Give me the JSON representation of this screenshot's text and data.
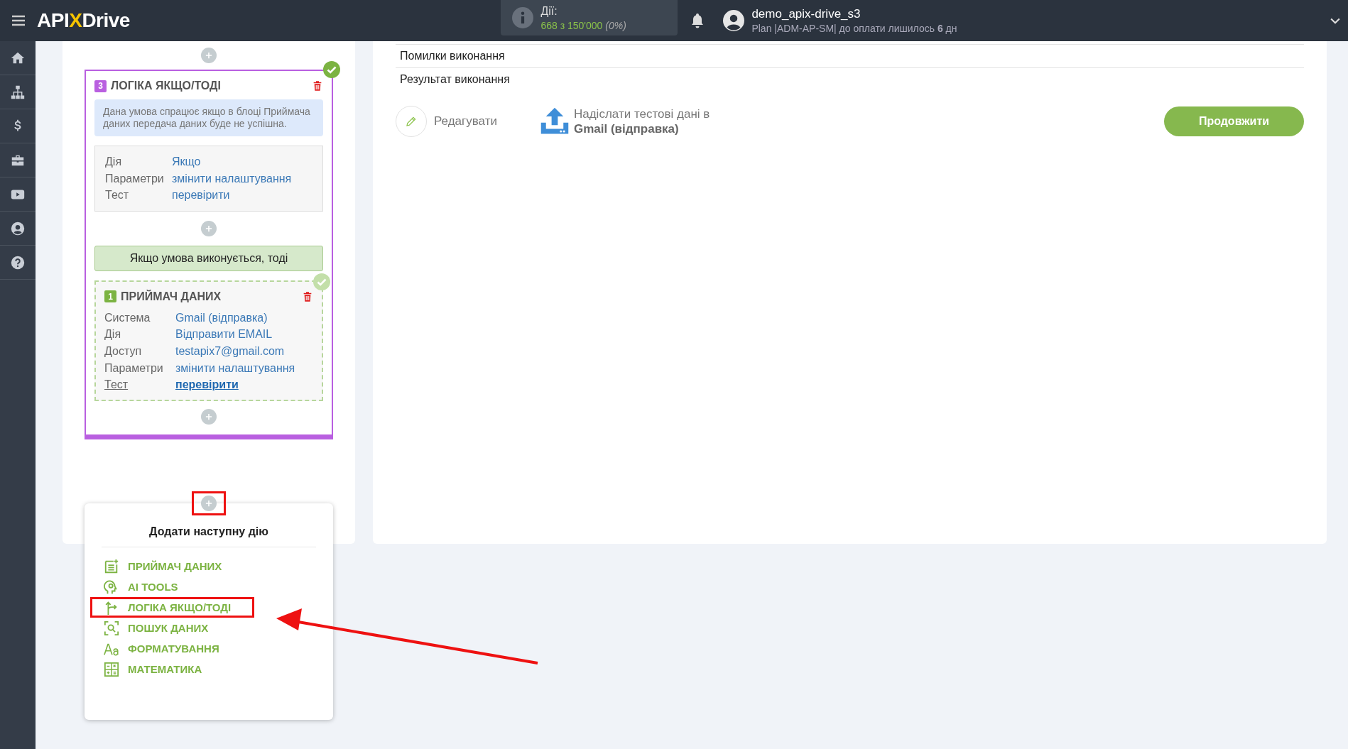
{
  "header": {
    "logo": {
      "left": "API",
      "mid": "X",
      "right": "Drive"
    },
    "actions": {
      "label": "Дії:",
      "count": "668",
      "of": "з 150'000",
      "percent": "(0%)"
    },
    "user": {
      "name": "demo_apix-drive_s3",
      "plan": "Plan |ADM-AP-SM| до оплати лишилось **6** дн"
    }
  },
  "logic_block": {
    "number": "3",
    "title": "ЛОГІКА ЯКЩО/ТОДІ",
    "done": true,
    "note": "Дана умова спрацює якщо в блоці Приймача даних передача даних буде не успішна.",
    "rows": [
      {
        "label": "Дія",
        "value": "Якщо",
        "hovered": false
      },
      {
        "label": "Параметри",
        "value": "змінити налаштування",
        "hovered": false
      },
      {
        "label": "Тест",
        "value": "перевірити",
        "hovered": false
      }
    ],
    "condition": "Якщо умова виконується, тоді",
    "receiver": {
      "number": "1",
      "title": "ПРИЙМАЧ ДАНИХ",
      "done": true,
      "active": false,
      "rows": [
        {
          "label": "Система",
          "value": "Gmail (відправка)",
          "hovered": false
        },
        {
          "label": "Дія",
          "value": "Відправити EMAIL",
          "hovered": false
        },
        {
          "label": "Доступ",
          "value": "testapix7@gmail.com",
          "hovered": false
        },
        {
          "label": "Параметри",
          "value": "змінити налаштування",
          "hovered": false
        },
        {
          "label": "Тест",
          "value": "перевірити",
          "hovered": true
        }
      ]
    }
  },
  "add_menu": {
    "plus_annotated": true,
    "title": "Додати наступну дію",
    "items": [
      {
        "kind": "receiver",
        "label": "ПРИЙМАЧ ДАНИХ",
        "annotated": false
      },
      {
        "kind": "ai",
        "label": "AI TOOLS",
        "annotated": false
      },
      {
        "kind": "logic",
        "label": "ЛОГІКА ЯКЩО/ТОДІ",
        "annotated": true
      },
      {
        "kind": "search",
        "label": "ПОШУК ДАНИХ",
        "annotated": false
      },
      {
        "kind": "format",
        "label": "ФОРМАТУВАННЯ",
        "annotated": false
      },
      {
        "kind": "math",
        "label": "МАТЕМАТИКА",
        "annotated": false
      }
    ]
  },
  "result": {
    "rows": [
      "Помилки виконання",
      "Результат виконання"
    ],
    "edit": "Редагувати",
    "send": "Надіслати тестові дані в **Gmail (відправка)**",
    "continue": "Продовжити"
  }
}
